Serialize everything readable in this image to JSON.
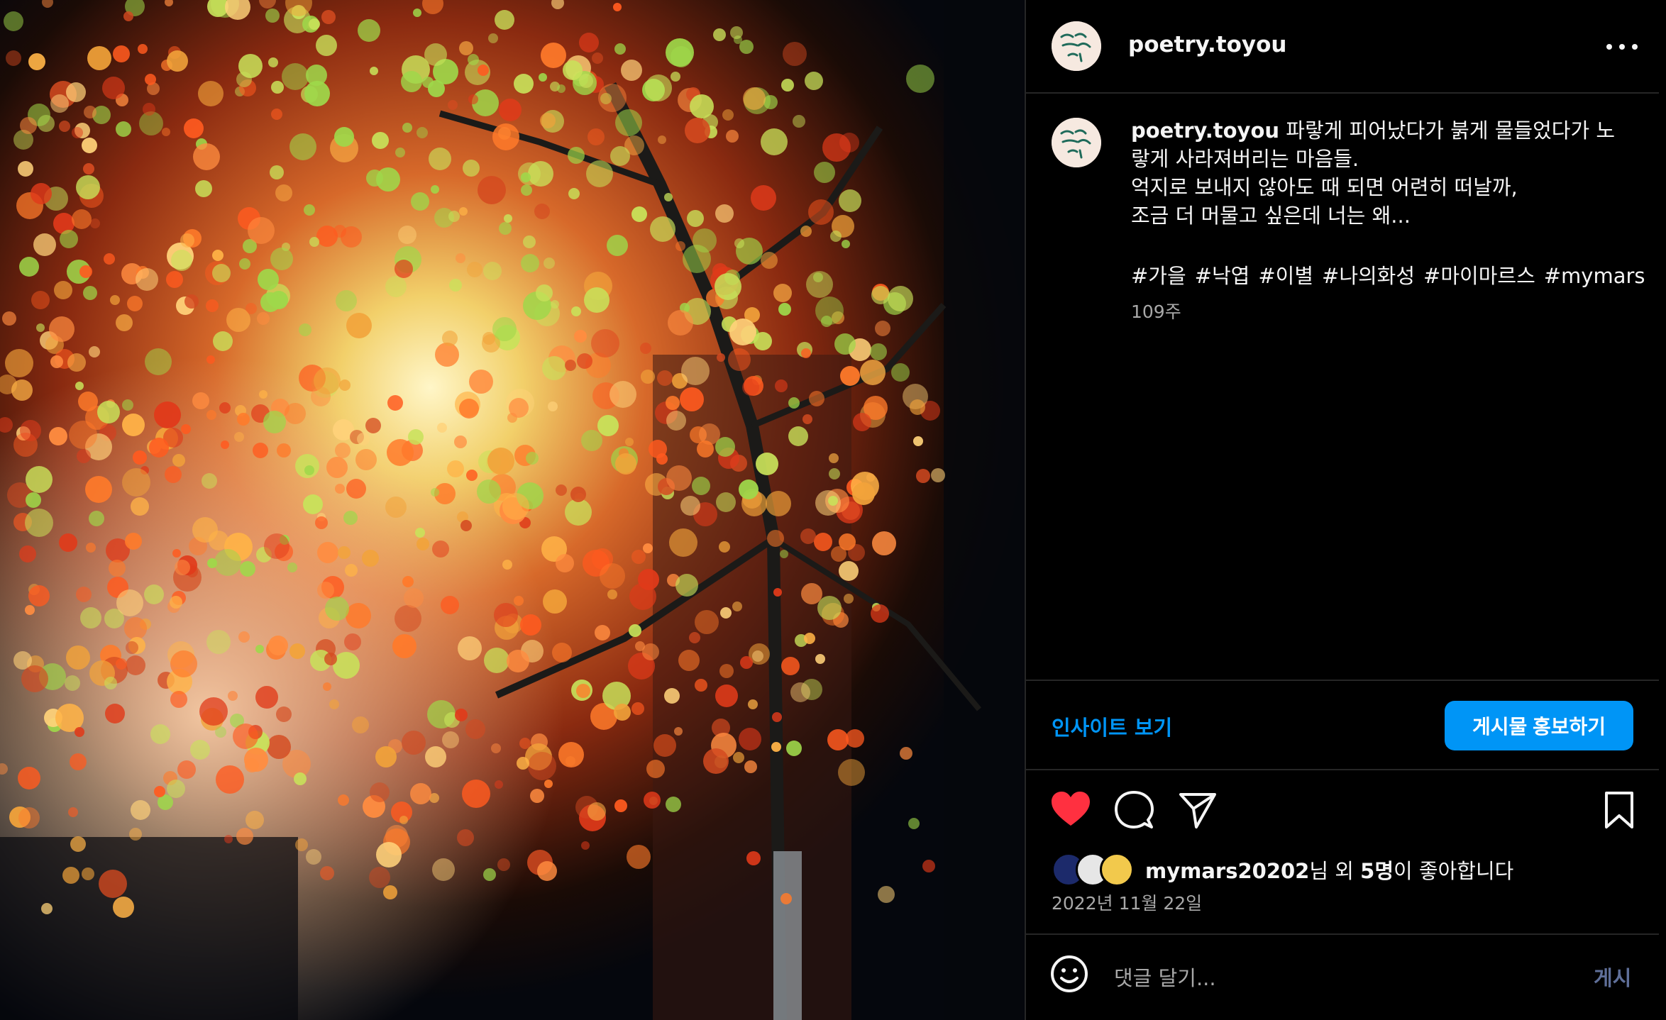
{
  "post": {
    "username": "poetry.toyou",
    "caption_lines": [
      "파랗게 피어났다가 붉게 물들었다가 노",
      "랗게 사라져버리는 마음들.",
      "억지로 보내지 않아도 때 되면 어련히 떠날까,",
      "조금 더 머물고 싶은데 너는 왜..."
    ],
    "hashtags": [
      "#가을",
      "#낙엽",
      "#이별",
      "#나의화성",
      "#마이마르스",
      "#mymars"
    ],
    "age": "109주",
    "insights_label": "인사이트 보기",
    "promote_label": "게시물 홍보하기",
    "liked_by_user": "mymars20202",
    "liked_suffix_1": "님 외 ",
    "liked_others": "5명",
    "liked_suffix_2": "이 좋아합니다",
    "date": "2022년 11월 22일",
    "comment_placeholder": "댓글 달기...",
    "post_button": "게시"
  },
  "icons": {
    "more": "more-options-icon",
    "like": "heart-filled-icon",
    "comment": "comment-icon",
    "share": "paper-plane-icon",
    "save": "bookmark-icon",
    "emoji": "emoji-icon"
  },
  "colors": {
    "accent": "#0095f6",
    "like": "#ff3040",
    "secondary_text": "#a8a8a8"
  }
}
